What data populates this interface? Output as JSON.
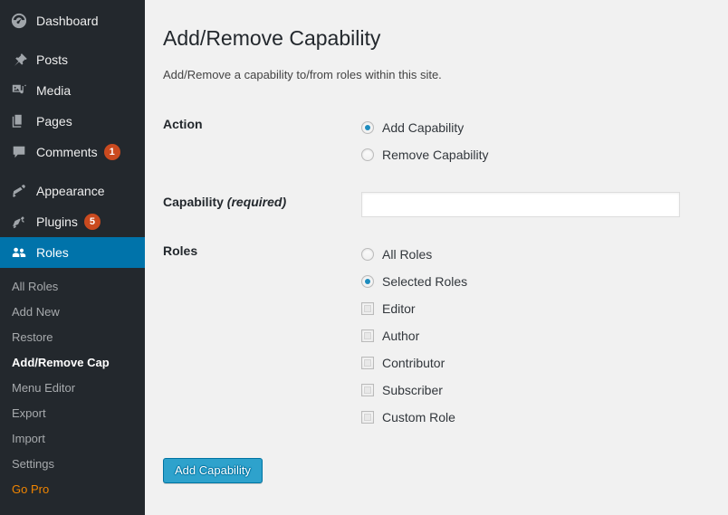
{
  "colors": {
    "sidebar_bg": "#23282d",
    "sidebar_active": "#0073aa",
    "badge": "#ca4a1f",
    "go_pro": "#f18500",
    "button": "#2ea2cc",
    "content_bg": "#f1f1f1"
  },
  "sidebar": {
    "items": [
      {
        "label": "Dashboard",
        "icon": "dashboard-icon",
        "badge": null,
        "active": false
      },
      {
        "label": "Posts",
        "icon": "pin-icon",
        "badge": null,
        "active": false
      },
      {
        "label": "Media",
        "icon": "media-icon",
        "badge": null,
        "active": false
      },
      {
        "label": "Pages",
        "icon": "pages-icon",
        "badge": null,
        "active": false
      },
      {
        "label": "Comments",
        "icon": "comments-icon",
        "badge": "1",
        "active": false
      },
      {
        "label": "Appearance",
        "icon": "paintbrush-icon",
        "badge": null,
        "active": false
      },
      {
        "label": "Plugins",
        "icon": "plug-icon",
        "badge": "5",
        "active": false
      },
      {
        "label": "Roles",
        "icon": "users-icon",
        "badge": null,
        "active": true
      }
    ],
    "submenu": [
      {
        "label": "All Roles",
        "current": false,
        "style": "normal"
      },
      {
        "label": "Add New",
        "current": false,
        "style": "normal"
      },
      {
        "label": "Restore",
        "current": false,
        "style": "normal"
      },
      {
        "label": "Add/Remove Cap",
        "current": true,
        "style": "normal"
      },
      {
        "label": "Menu Editor",
        "current": false,
        "style": "normal"
      },
      {
        "label": "Export",
        "current": false,
        "style": "normal"
      },
      {
        "label": "Import",
        "current": false,
        "style": "normal"
      },
      {
        "label": "Settings",
        "current": false,
        "style": "normal"
      },
      {
        "label": "Go Pro",
        "current": false,
        "style": "gopro"
      }
    ]
  },
  "page": {
    "title": "Add/Remove Capability",
    "description": "Add/Remove a capability to/from roles within this site."
  },
  "form": {
    "action": {
      "label": "Action",
      "options": [
        {
          "label": "Add Capability",
          "checked": true
        },
        {
          "label": "Remove Capability",
          "checked": false
        }
      ]
    },
    "capability": {
      "label": "Capability",
      "required_text": "(required)",
      "value": "",
      "placeholder": ""
    },
    "roles": {
      "label": "Roles",
      "radios": [
        {
          "label": "All Roles",
          "checked": false
        },
        {
          "label": "Selected Roles",
          "checked": true
        }
      ],
      "checkboxes": [
        {
          "label": "Editor",
          "checked": false
        },
        {
          "label": "Author",
          "checked": false
        },
        {
          "label": "Contributor",
          "checked": false
        },
        {
          "label": "Subscriber",
          "checked": false
        },
        {
          "label": "Custom Role",
          "checked": false
        }
      ]
    },
    "submit_label": "Add Capability"
  }
}
